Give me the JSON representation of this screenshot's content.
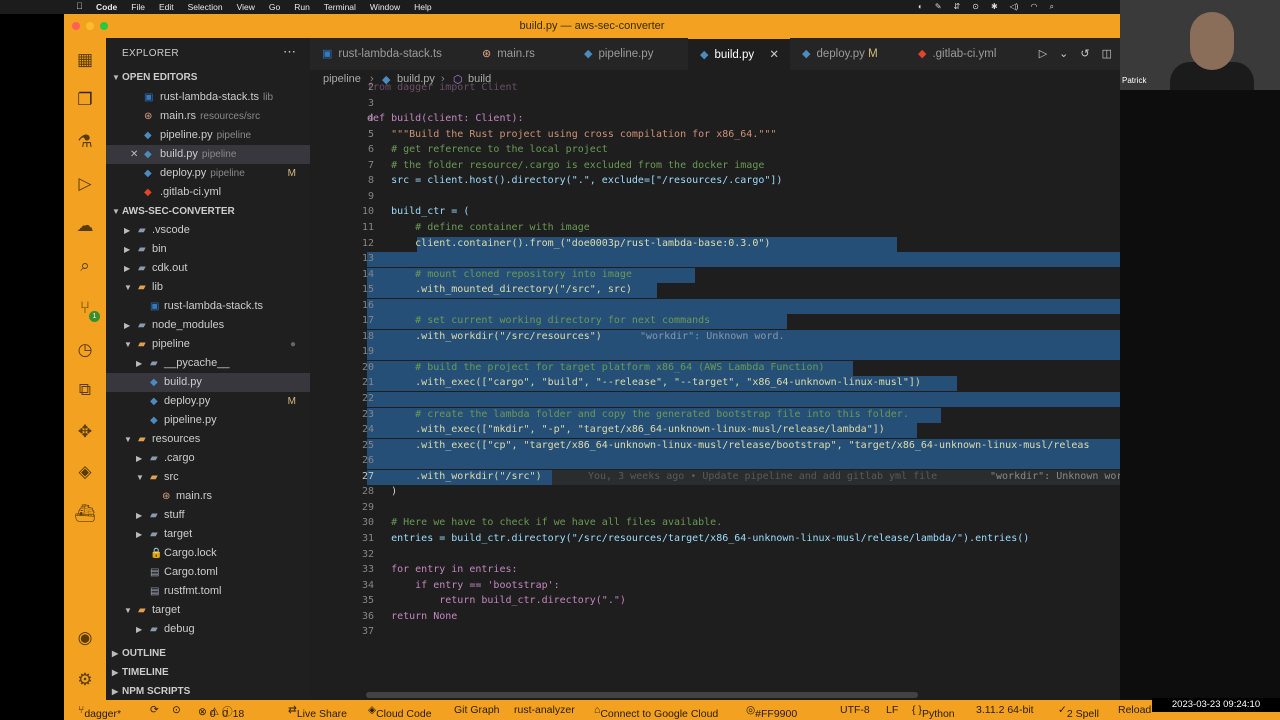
{
  "menubar": {
    "apple": "",
    "items": [
      "Code",
      "File",
      "Edit",
      "Selection",
      "View",
      "Go",
      "Run",
      "Terminal",
      "Window",
      "Help"
    ]
  },
  "window": {
    "title": "build.py — aws-sec-converter"
  },
  "sidebar": {
    "title": "EXPLORER",
    "open_editors_label": "OPEN EDITORS",
    "open_editors": [
      {
        "name": "rust-lambda-stack.ts",
        "hint": "lib",
        "icon": "ts",
        "color": "#3178c6"
      },
      {
        "name": "main.rs",
        "hint": "resources/src",
        "icon": "rs",
        "color": "#dea584"
      },
      {
        "name": "pipeline.py",
        "hint": "pipeline",
        "icon": "py",
        "color": "#4b8bbe"
      },
      {
        "name": "build.py",
        "hint": "pipeline",
        "icon": "py",
        "color": "#4b8bbe"
      },
      {
        "name": "deploy.py",
        "hint": "pipeline",
        "mark": "M",
        "icon": "py",
        "color": "#4b8bbe"
      },
      {
        "name": ".gitlab-ci.yml",
        "hint": "",
        "icon": "yml",
        "color": "#e24329"
      }
    ],
    "project_label": "AWS-SEC-CONVERTER",
    "tree": [
      {
        "name": ".vscode",
        "kind": "folder",
        "depth": 1,
        "open": false
      },
      {
        "name": "bin",
        "kind": "folder",
        "depth": 1,
        "open": false
      },
      {
        "name": "cdk.out",
        "kind": "folder",
        "depth": 1,
        "open": false
      },
      {
        "name": "lib",
        "kind": "folder",
        "depth": 1,
        "open": true
      },
      {
        "name": "rust-lambda-stack.ts",
        "kind": "file",
        "depth": 2
      },
      {
        "name": "node_modules",
        "kind": "folder",
        "depth": 1,
        "open": false
      },
      {
        "name": "pipeline",
        "kind": "folder",
        "depth": 1,
        "open": true
      },
      {
        "name": "__pycache__",
        "kind": "folder",
        "depth": 2,
        "open": false
      },
      {
        "name": "build.py",
        "kind": "file",
        "depth": 2
      },
      {
        "name": "deploy.py",
        "kind": "file",
        "depth": 2,
        "mark": "M"
      },
      {
        "name": "pipeline.py",
        "kind": "file",
        "depth": 2
      },
      {
        "name": "resources",
        "kind": "folder",
        "depth": 1,
        "open": true
      },
      {
        "name": ".cargo",
        "kind": "folder",
        "depth": 2,
        "open": false
      },
      {
        "name": "src",
        "kind": "folder",
        "depth": 2,
        "open": true
      },
      {
        "name": "main.rs",
        "kind": "file",
        "depth": 3
      },
      {
        "name": "stuff",
        "kind": "folder",
        "depth": 2,
        "open": false
      },
      {
        "name": "target",
        "kind": "folder",
        "depth": 2,
        "open": false
      },
      {
        "name": "Cargo.lock",
        "kind": "file",
        "depth": 2
      },
      {
        "name": "Cargo.toml",
        "kind": "file",
        "depth": 2
      },
      {
        "name": "rustfmt.toml",
        "kind": "file",
        "depth": 2
      },
      {
        "name": "target",
        "kind": "folder",
        "depth": 1,
        "open": true
      },
      {
        "name": "debug",
        "kind": "folder",
        "depth": 2,
        "open": false
      }
    ],
    "outline_label": "OUTLINE",
    "timeline_label": "TIMELINE",
    "npm_label": "NPM SCRIPTS"
  },
  "tabs": [
    {
      "name": "rust-lambda-stack.ts",
      "icon": "ts"
    },
    {
      "name": "main.rs",
      "icon": "rs"
    },
    {
      "name": "pipeline.py",
      "icon": "py"
    },
    {
      "name": "build.py",
      "icon": "py",
      "active": true
    },
    {
      "name": "deploy.py",
      "icon": "py",
      "mark": "M"
    },
    {
      "name": ".gitlab-ci.yml",
      "icon": "yml"
    }
  ],
  "breadcrumb": [
    "pipeline",
    "build.py",
    "build"
  ],
  "code_lines": [
    {
      "n": "2",
      "t": "from dagger import Client"
    },
    {
      "n": "3",
      "t": ""
    },
    {
      "n": "4",
      "t": "def build(client: Client):"
    },
    {
      "n": "5",
      "t": "    \"\"\"Build the Rust project using cross compilation for x86_64.\"\"\""
    },
    {
      "n": "6",
      "t": "    # get reference to the local project"
    },
    {
      "n": "7",
      "t": "    # the folder resource/.cargo is excluded from the docker image"
    },
    {
      "n": "8",
      "t": "    src = client.host().directory(\".\", exclude=[\"/resources/.cargo\"])"
    },
    {
      "n": "9",
      "t": ""
    },
    {
      "n": "10",
      "t": "    build_ctr = ("
    },
    {
      "n": "11",
      "t": "        # define container with image"
    },
    {
      "n": "12",
      "t": "        client.container().from_(\"doe0003p/rust-lambda-base:0.3.0\")"
    },
    {
      "n": "13",
      "t": ""
    },
    {
      "n": "14",
      "t": "        # mount cloned repository into image"
    },
    {
      "n": "15",
      "t": "        .with_mounted_directory(\"/src\", src)"
    },
    {
      "n": "16",
      "t": ""
    },
    {
      "n": "17",
      "t": "        # set current working directory for next commands"
    },
    {
      "n": "18",
      "t": "        .with_workdir(\"/src/resources\")"
    },
    {
      "n": "19",
      "t": ""
    },
    {
      "n": "20",
      "t": "        # build the project for target platform x86_64 (AWS Lambda Function)"
    },
    {
      "n": "21",
      "t": "        .with_exec([\"cargo\", \"build\", \"--release\", \"--target\", \"x86_64-unknown-linux-musl\"])"
    },
    {
      "n": "22",
      "t": ""
    },
    {
      "n": "23",
      "t": "        # create the lambda folder and copy the generated bootstrap file into this folder."
    },
    {
      "n": "24",
      "t": "        .with_exec([\"mkdir\", \"-p\", \"target/x86_64-unknown-linux-musl/release/lambda\"])"
    },
    {
      "n": "25",
      "t": "        .with_exec([\"cp\", \"target/x86_64-unknown-linux-musl/release/bootstrap\", \"target/x86_64-unknown-linux-musl/releas"
    },
    {
      "n": "26",
      "t": ""
    },
    {
      "n": "27",
      "t": "        .with_workdir(\"/src\")"
    },
    {
      "n": "28",
      "t": "    )"
    },
    {
      "n": "29",
      "t": ""
    },
    {
      "n": "30",
      "t": "    # Here we have to check if we have all files available."
    },
    {
      "n": "31",
      "t": "    entries = build_ctr.directory(\"/src/resources/target/x86_64-unknown-linux-musl/release/lambda/\").entries()"
    },
    {
      "n": "32",
      "t": ""
    },
    {
      "n": "33",
      "t": "    for entry in entries:"
    },
    {
      "n": "34",
      "t": "        if entry == 'bootstrap':"
    },
    {
      "n": "35",
      "t": "            return build_ctr.directory(\".\")"
    },
    {
      "n": "36",
      "t": "    return None"
    },
    {
      "n": "37",
      "t": ""
    }
  ],
  "inline_hints": {
    "line18": "\"workdir\": Unknown word.",
    "line27_blame": "You, 3 weeks ago • Update pipeline and add gitlab yml file",
    "line27_warn": "\"workdir\": Unknown wor"
  },
  "webcam": {
    "name": "Patrick"
  },
  "statusbar": {
    "branch": "dagger*",
    "errors": "0",
    "warnings": "0",
    "infos": "18",
    "live_share": "Live Share",
    "cloud_code": "Cloud Code",
    "git_graph": "Git Graph",
    "rust_analyzer": "rust-analyzer",
    "google_cloud": "Connect to Google Cloud",
    "color": "#FF9900",
    "encoding": "UTF-8",
    "eol": "LF",
    "language": "Python",
    "python_version": "3.11.2 64-bit",
    "spell": "2 Spell",
    "reload": "Reload"
  },
  "clock": "2023-03-23  09:24:10"
}
